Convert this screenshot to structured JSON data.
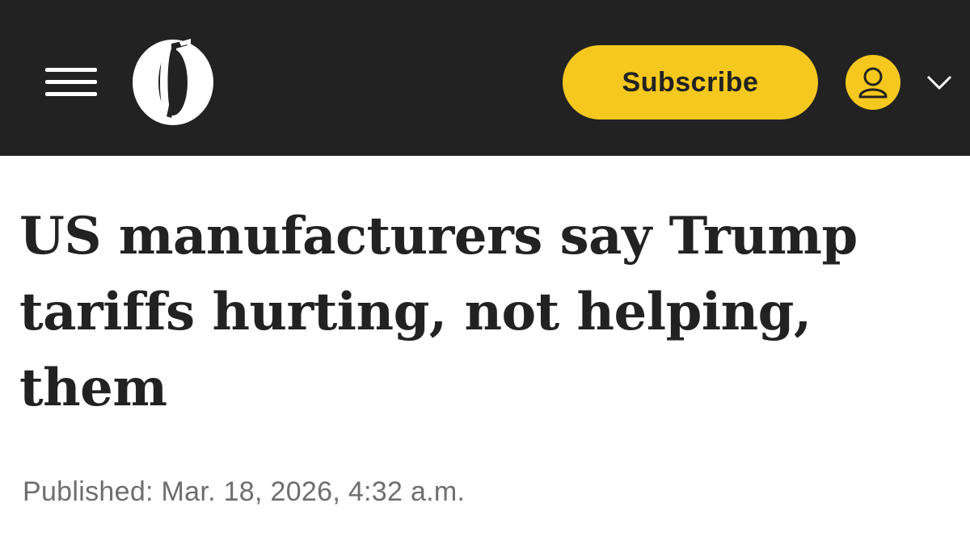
{
  "header": {
    "menu_icon": "hamburger-menu-icon",
    "logo_icon": "oregonian-o-logo",
    "subscribe_label": "Subscribe",
    "account_icon": "user-avatar-icon",
    "account_menu_icon": "chevron-down-icon",
    "colors": {
      "background": "#222222",
      "accent": "#f4c81e"
    }
  },
  "article": {
    "headline": "US manufacturers say Trump tariffs hurting, not helping, them",
    "published": "Published: Mar. 18, 2026, 4:32 a.m."
  }
}
